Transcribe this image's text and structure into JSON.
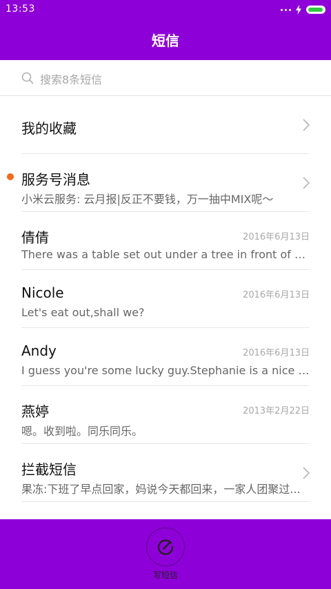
{
  "status_bar": {
    "time": "13:53"
  },
  "header": {
    "title": "短信"
  },
  "search": {
    "placeholder": "搜索8条短信"
  },
  "conversations": [
    {
      "title": "我的收藏",
      "preview": "",
      "date": "",
      "has_chevron": true,
      "unread": false
    },
    {
      "title": "服务号消息",
      "preview": "小米云服务: 云月报|反正不要钱，万一抽中MIX呢～",
      "date": "",
      "has_chevron": true,
      "unread": true
    },
    {
      "title": "倩倩",
      "preview": "There was a table set out under a tree in front of the ho...",
      "date": "2016年6月13日",
      "has_chevron": false,
      "unread": false
    },
    {
      "title": "Nicole",
      "preview": "Let's eat out,shall we?",
      "date": "2016年6月13日",
      "has_chevron": false,
      "unread": false
    },
    {
      "title": "Andy",
      "preview": "I guess you're some lucky guy.Stephanie is a nice girl.",
      "date": "2016年6月13日",
      "has_chevron": false,
      "unread": false
    },
    {
      "title": "燕婷",
      "preview": "嗯。收到啦。同乐同乐。",
      "date": "2013年2月22日",
      "has_chevron": false,
      "unread": false
    },
    {
      "title": "拦截短信",
      "preview": "果冻:下班了早点回家，妈说今天都回来，一家人团聚过...",
      "date": "",
      "has_chevron": true,
      "unread": false
    }
  ],
  "bottom": {
    "compose_label": "写短信"
  },
  "colors": {
    "primary": "#8e00d8",
    "unread_dot": "#f26a1b",
    "battery": "#2ecc40"
  },
  "icons": {
    "search": "search-icon",
    "chevron": "chevron-right-icon",
    "compose": "compose-icon",
    "battery": "battery-icon",
    "charging": "charging-bolt-icon",
    "signal": "signal-dots-icon"
  }
}
